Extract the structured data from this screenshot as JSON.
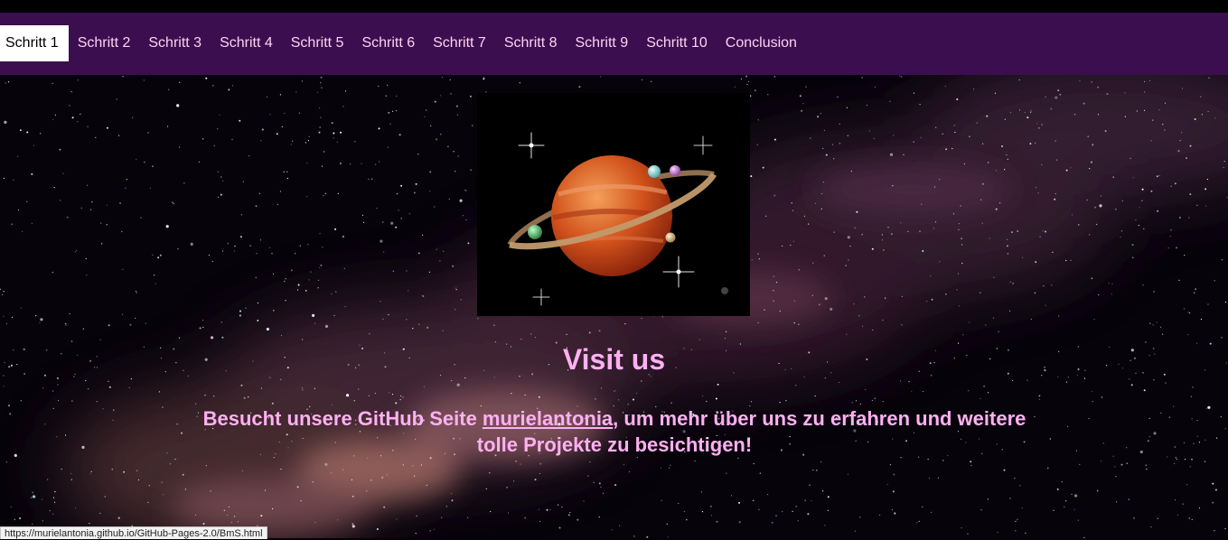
{
  "nav": {
    "items": [
      {
        "label": "Schritt 1",
        "active": true
      },
      {
        "label": "Schritt 2"
      },
      {
        "label": "Schritt 3"
      },
      {
        "label": "Schritt 4"
      },
      {
        "label": "Schritt 5"
      },
      {
        "label": "Schritt 6"
      },
      {
        "label": "Schritt 7"
      },
      {
        "label": "Schritt 8"
      },
      {
        "label": "Schritt 9"
      },
      {
        "label": "Schritt 10"
      },
      {
        "label": "Conclusion"
      }
    ]
  },
  "main": {
    "heading": "Visit us",
    "text_before": "Besucht unsere GitHub Seite ",
    "link_label": "murielantonia",
    "text_after": ", um mehr über uns zu erfahren und weitere tolle Projekte zu besichtigen!"
  },
  "status_url": "https://murielantonia.github.io/GitHub-Pages-2.0/BmS.html",
  "colors": {
    "nav_bg": "#3b0f4f",
    "accent_text": "#ffb0f2",
    "nav_text": "#ffd1f2"
  }
}
